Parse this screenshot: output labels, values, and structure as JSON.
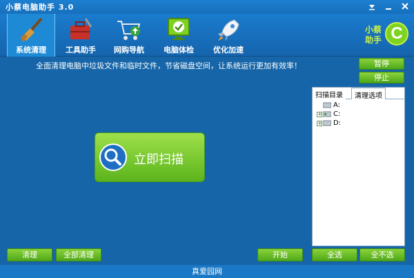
{
  "window": {
    "title": "小蔡电脑助手 3.0"
  },
  "toolbar": {
    "items": [
      {
        "label": "系统清理",
        "icon": "broom-icon"
      },
      {
        "label": "工具助手",
        "icon": "toolbox-icon"
      },
      {
        "label": "网购导航",
        "icon": "shopping-cart-icon"
      },
      {
        "label": "电脑体检",
        "icon": "monitor-check-icon"
      },
      {
        "label": "优化加速",
        "icon": "rocket-icon"
      }
    ],
    "brand": {
      "line1": "小蔡",
      "line2": "助手",
      "logo": "C"
    }
  },
  "main": {
    "info": "全面清理电脑中垃圾文件和临时文件，节省磁盘空间，让系统运行更加有效率！",
    "pause_label": "暂停",
    "stop_label": "停止",
    "scan_label": "立即扫描"
  },
  "panel": {
    "tabs": [
      "扫描目录",
      "清理选项"
    ],
    "drives": [
      "A:",
      "C:",
      "D:"
    ]
  },
  "bottom": {
    "clean_label": "清理",
    "clean_all_label": "全部清理",
    "start_label": "开始",
    "select_all_label": "全选",
    "select_none_label": "全不选"
  },
  "status": {
    "text": "真爱园网"
  },
  "colors": {
    "background": "#1565a8",
    "button_green": "#5cb41c",
    "accent_lime": "#c8f04a"
  }
}
